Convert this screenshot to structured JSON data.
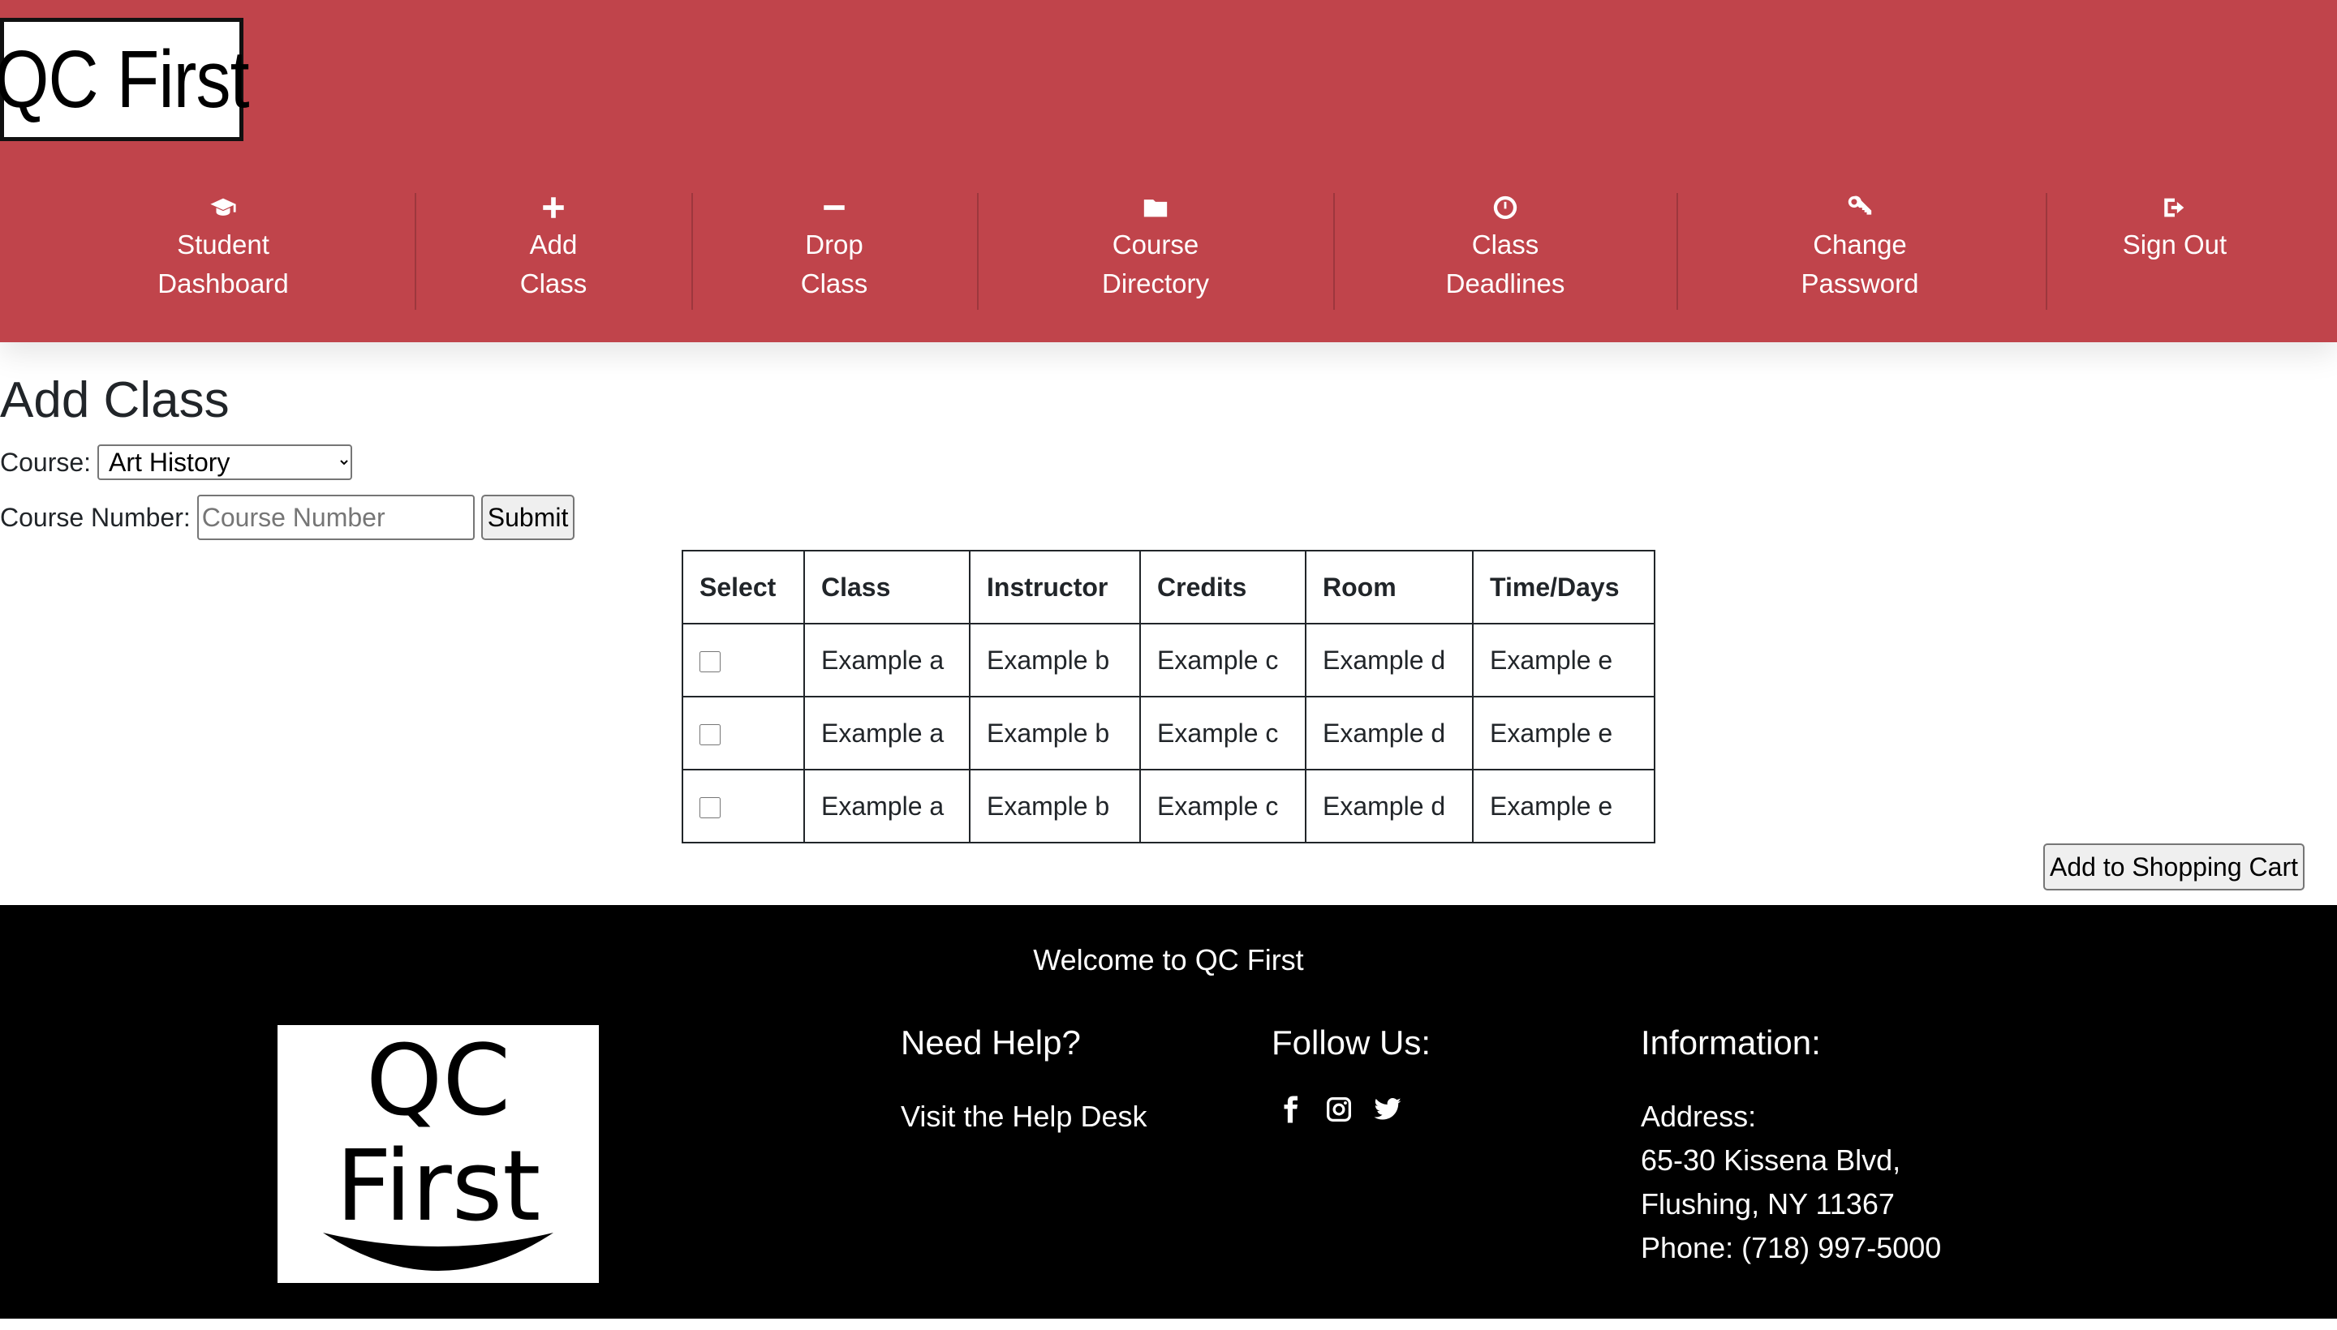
{
  "header": {
    "logo_text": "QC First",
    "nav": [
      {
        "label": "Student Dashboard",
        "icon": "graduation-cap-icon"
      },
      {
        "label": "Add Class",
        "icon": "plus-icon"
      },
      {
        "label": "Drop Class",
        "icon": "minus-icon"
      },
      {
        "label": "Course Directory",
        "icon": "folder-icon"
      },
      {
        "label": "Class Deadlines",
        "icon": "clock-icon"
      },
      {
        "label": "Change Password",
        "icon": "key-icon"
      },
      {
        "label": "Sign Out",
        "icon": "sign-out-icon"
      }
    ]
  },
  "main": {
    "title": "Add Class",
    "course_label": "Course:",
    "course_selected": "Art History",
    "course_number_label": "Course Number:",
    "course_number_placeholder": "Course Number",
    "submit_label": "Submit",
    "table": {
      "headers": [
        "Select",
        "Class",
        "Instructor",
        "Credits",
        "Room",
        "Time/Days"
      ],
      "rows": [
        {
          "checked": false,
          "cells": [
            "Example a",
            "Example b",
            "Example c",
            "Example d",
            "Example e"
          ]
        },
        {
          "checked": false,
          "cells": [
            "Example a",
            "Example b",
            "Example c",
            "Example d",
            "Example e"
          ]
        },
        {
          "checked": false,
          "cells": [
            "Example a",
            "Example b",
            "Example c",
            "Example d",
            "Example e"
          ]
        }
      ]
    },
    "cart_button_label": "Add to Shopping Cart"
  },
  "footer": {
    "welcome": "Welcome to QC First",
    "logo_lines": [
      "QC",
      "First"
    ],
    "help_heading": "Need Help?",
    "help_link": "Visit the Help Desk",
    "follow_heading": "Follow Us:",
    "social_icons": [
      "facebook-icon",
      "instagram-icon",
      "twitter-icon"
    ],
    "info_heading": "Information:",
    "address_label": "Address:",
    "address_line1": "65-30 Kissena Blvd,",
    "address_line2": "Flushing, NY 11367",
    "phone": "Phone: (718) 997-5000"
  },
  "colors": {
    "header_bg": "#c0444b",
    "footer_bg": "#000000",
    "text": "#212529"
  }
}
